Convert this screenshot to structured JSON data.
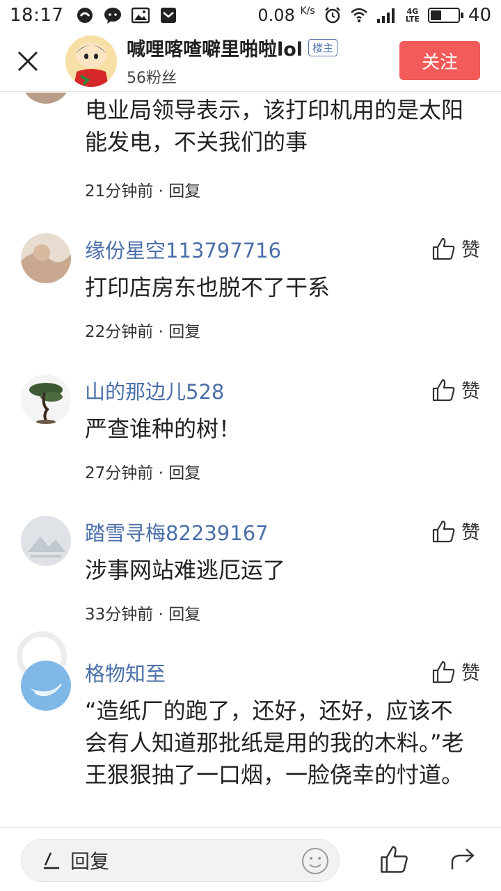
{
  "status_bar": {
    "time": "18:17",
    "speed": "0.08",
    "speed_unit": "K/s",
    "network": "4G",
    "battery": "40",
    "battery_level": 0.4
  },
  "header": {
    "username": "喊哩喀喳噼里啪啦lol",
    "badge": "楼主",
    "fans": "56粉丝",
    "follow_label": "关注"
  },
  "comments": [
    {
      "name": "",
      "text": "电业局领导表示，该打印机用的是太阳能发电，不关我们的事",
      "time": "21分钟前",
      "reply": "回复",
      "like": ""
    },
    {
      "name": "缘份星空113797716",
      "text": "打印店房东也脱不了干系",
      "time": "22分钟前",
      "reply": "回复",
      "like": "赞"
    },
    {
      "name": "山的那边儿528",
      "text": "严查谁种的树！",
      "time": "27分钟前",
      "reply": "回复",
      "like": "赞"
    },
    {
      "name": "踏雪寻梅82239167",
      "text": "涉事网站难逃厄运了",
      "time": "33分钟前",
      "reply": "回复",
      "like": "赞"
    },
    {
      "name": "格物知至",
      "text": "“造纸厂的跑了，还好，还好，应该不会有人知道那批纸是用的我的木料。”老王狠狠抽了一口烟，一脸侥幸的忖道。",
      "time": "",
      "reply": "",
      "like": "赞"
    }
  ],
  "bottom_bar": {
    "reply_placeholder": "回复"
  }
}
